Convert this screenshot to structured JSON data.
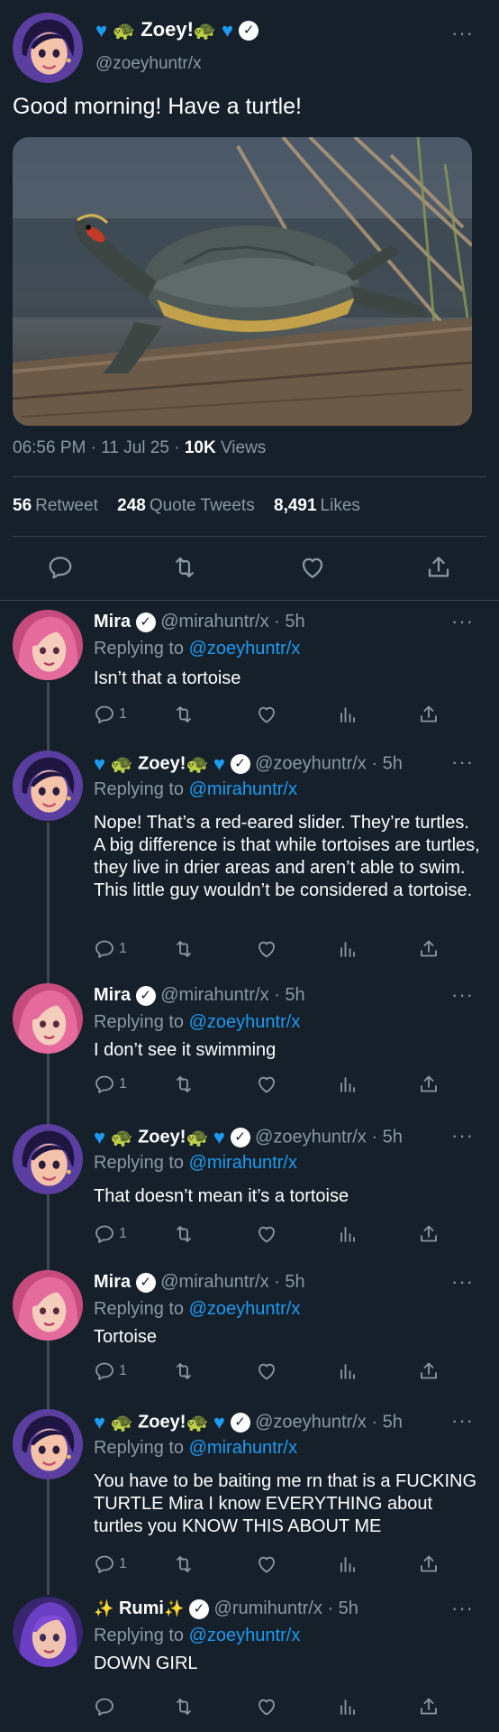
{
  "main_tweet": {
    "author_name": "Zoey!",
    "handle": "@zoeyhuntr/x",
    "text": "Good morning! Have a turtle!",
    "time": "06:56 PM",
    "date": "11 Jul 25",
    "views_count": "10K",
    "views_label": "Views",
    "retweets_count": "56",
    "retweets_label": "Retweet",
    "quotes_count": "248",
    "quotes_label": "Quote Tweets",
    "likes_count": "8,491",
    "likes_label": "Likes",
    "more_label": "···"
  },
  "replies": [
    {
      "name": "Mira",
      "handle": "@mirahuntr/x",
      "time": "5h",
      "replying_prefix": "Replying to",
      "replying_to": "@zoeyhuntr/x",
      "text": "Isn’t that a tortoise",
      "reply_count": "1"
    },
    {
      "name": "Zoey!",
      "handle": "@zoeyhuntr/x",
      "time": "5h",
      "replying_prefix": "Replying to",
      "replying_to": "@mirahuntr/x",
      "text": "Nope! That’s a red-eared slider. They’re turtles. A big difference is that while tortoises are turtles, they live in drier areas and aren’t able to swim. This little guy wouldn’t be considered a tortoise.",
      "reply_count": "1"
    },
    {
      "name": "Mira",
      "handle": "@mirahuntr/x",
      "time": "5h",
      "replying_prefix": "Replying to",
      "replying_to": "@zoeyhuntr/x",
      "text": "I don’t see it swimming",
      "reply_count": "1"
    },
    {
      "name": "Zoey!",
      "handle": "@zoeyhuntr/x",
      "time": "5h",
      "replying_prefix": "Replying to",
      "replying_to": "@mirahuntr/x",
      "text": "That doesn’t mean it’s a tortoise",
      "reply_count": "1"
    },
    {
      "name": "Mira",
      "handle": "@mirahuntr/x",
      "time": "5h",
      "replying_prefix": "Replying to",
      "replying_to": "@zoeyhuntr/x",
      "text": "Tortoise",
      "reply_count": "1"
    },
    {
      "name": "Zoey!",
      "handle": "@zoeyhuntr/x",
      "time": "5h",
      "replying_prefix": "Replying to",
      "replying_to": "@mirahuntr/x",
      "text": "You have to be baiting me rn that is a FUCKING TURTLE Mira I know EVERYTHING about turtles you KNOW THIS ABOUT ME",
      "reply_count": "1"
    },
    {
      "name": "Rumi",
      "handle": "@rumihuntr/x",
      "time": "5h",
      "replying_prefix": "Replying to",
      "replying_to": "@zoeyhuntr/x",
      "text": "DOWN GIRL",
      "reply_count": ""
    }
  ],
  "icons": {
    "reply": "reply-icon",
    "retweet": "retweet-icon",
    "like": "heart-icon",
    "views": "analytics-icon",
    "share": "share-icon",
    "verified": "verified-badge-icon",
    "blue_heart": "blue-heart-emoji",
    "turtle": "turtle-emoji",
    "sparkles": "sparkles-emoji"
  },
  "colors": {
    "background": "#15202b",
    "accent": "#1d9bf0",
    "muted": "#8b98a5",
    "divider": "#38444d"
  }
}
